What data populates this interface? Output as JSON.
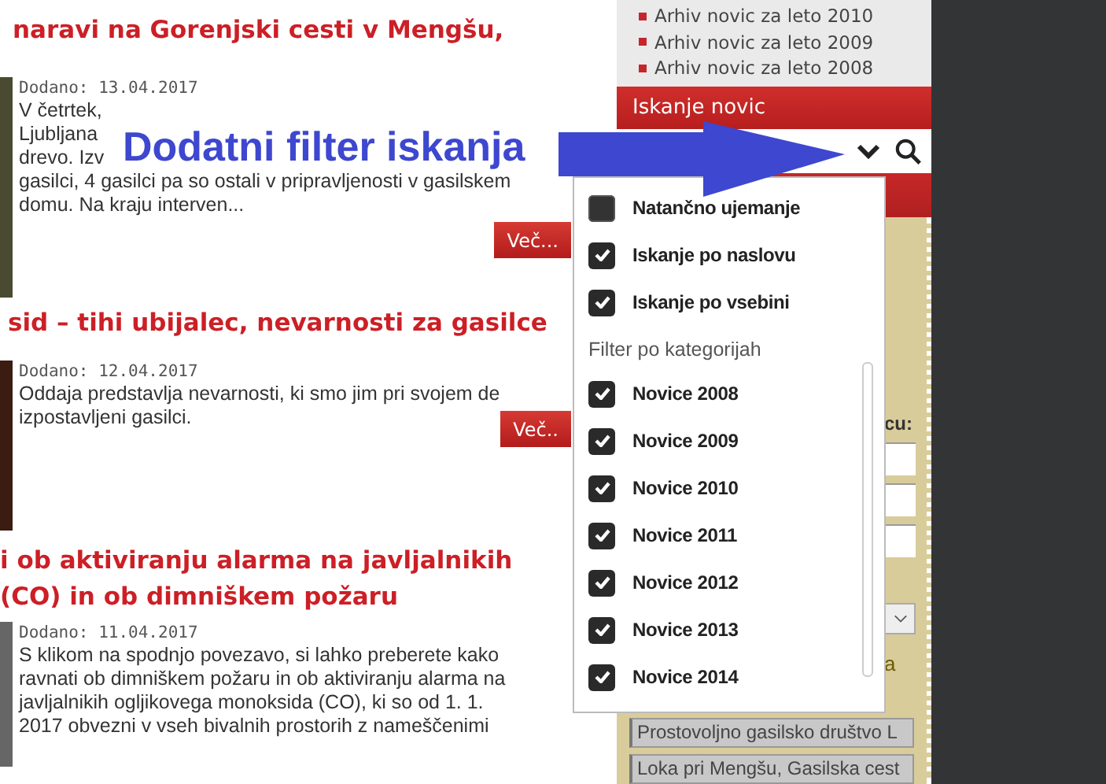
{
  "articles": [
    {
      "title_lines": [
        "naravi na Gorenjski cesti v Mengšu,"
      ],
      "date": "Dodano: 13.04.2017",
      "text_lines": [
        "V četrtek,",
        "Ljubljana",
        "drevo. Izv",
        "gasilci, 4 gasilci pa so ostali v pripravljenosti v gasilskem",
        "domu. Na kraju interven..."
      ],
      "more": "Več..."
    },
    {
      "title_lines": [
        "sid – tihi ubijalec, nevarnosti za gasilce"
      ],
      "date": "Dodano: 12.04.2017",
      "text_lines": [
        "Oddaja predstavlja nevarnosti, ki smo jim pri svojem de",
        "izpostavljeni gasilci."
      ],
      "more": "Več.."
    },
    {
      "title_lines": [
        "i ob aktiviranju alarma na javljalnikih",
        "(CO) in ob dimniškem požaru"
      ],
      "date": "Dodano: 11.04.2017",
      "text_lines": [
        "S klikom na spodnjo povezavo, si lahko preberete kako",
        "ravnati ob dimniškem požaru in ob aktiviranju alarma na",
        "javljalnikih ogljikovega monoksida (CO), ki so od 1. 1.",
        "2017 obvezni v vseh bivalnih prostorih z nameščenimi"
      ]
    }
  ],
  "sidebar": {
    "archive_links": [
      "Arhiv novic za leto 2010",
      "Arhiv novic za leto 2009",
      "Arhiv novic za leto 2008"
    ],
    "search_header": "Iskanje novic",
    "form_label": "cu:",
    "form_note": "a",
    "fields": [
      "Prostovoljno gasilsko društvo L",
      "Loka pri Mengšu, Gasilska cest"
    ]
  },
  "filter_dropdown": {
    "options": [
      {
        "label": "Natančno ujemanje",
        "checked": false
      },
      {
        "label": "Iskanje po naslovu",
        "checked": true
      },
      {
        "label": "Iskanje po vsebini",
        "checked": true
      }
    ],
    "section_label": "Filter po kategorijah",
    "categories": [
      {
        "label": "Novice 2008",
        "checked": true
      },
      {
        "label": "Novice 2009",
        "checked": true
      },
      {
        "label": "Novice 2010",
        "checked": true
      },
      {
        "label": "Novice 2011",
        "checked": true
      },
      {
        "label": "Novice 2012",
        "checked": true
      },
      {
        "label": "Novice 2013",
        "checked": true
      },
      {
        "label": "Novice 2014",
        "checked": true
      }
    ]
  },
  "annotation": {
    "text": "Dodatni filter iskanja"
  }
}
